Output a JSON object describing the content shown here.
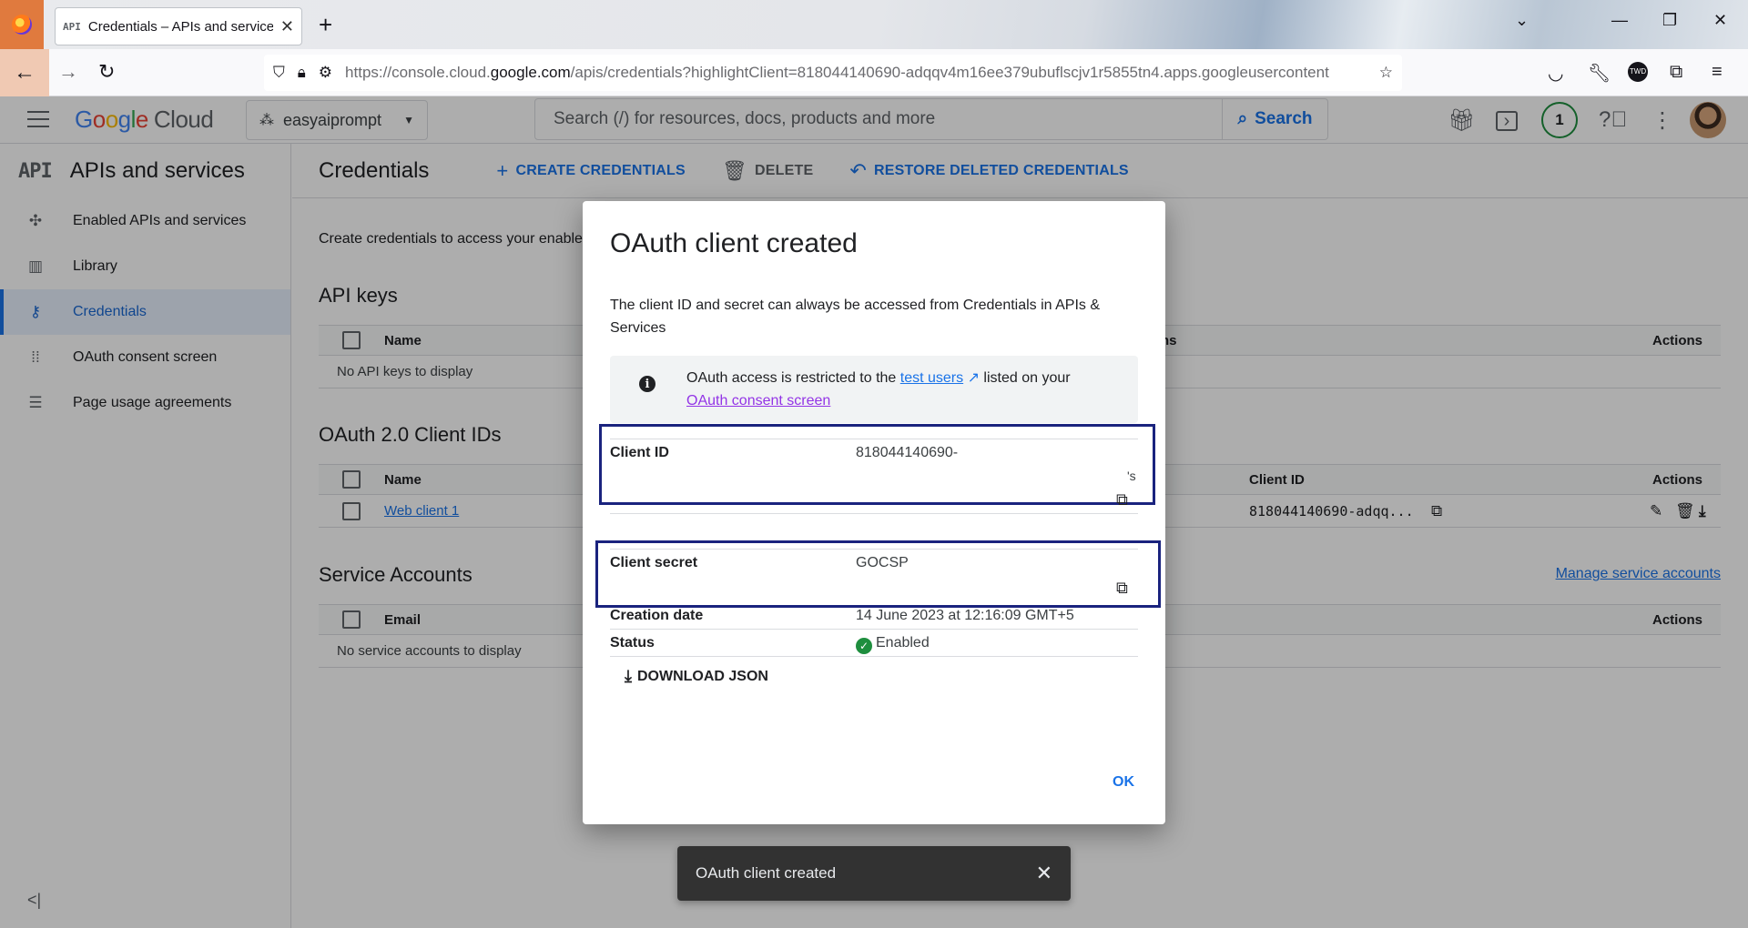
{
  "browser": {
    "tab_title": "Credentials – APIs and services",
    "tab_favicon": "API",
    "url_prefix": "https://console.cloud.",
    "url_domain": "google.com",
    "url_rest": "/apis/credentials?highlightClient=818044140690-adqqv4m16ee379ubuflscjv1r5855tn4.apps.googleusercontent"
  },
  "header": {
    "logo_letters": [
      "G",
      "o",
      "o",
      "g",
      "l",
      "e"
    ],
    "logo_suffix": "Cloud",
    "project_name": "easyaiprompt",
    "search_placeholder": "Search (/) for resources, docs, products and more",
    "search_button": "Search",
    "notifications_count": "1"
  },
  "sidebar": {
    "product_abbr": "API",
    "product_title": "APIs and services",
    "items": [
      {
        "label": "Enabled APIs and services",
        "icon": "enabled-apis-icon"
      },
      {
        "label": "Library",
        "icon": "library-icon"
      },
      {
        "label": "Credentials",
        "icon": "key-icon"
      },
      {
        "label": "OAuth consent screen",
        "icon": "consent-screen-icon"
      },
      {
        "label": "Page usage agreements",
        "icon": "settings-list-icon"
      }
    ],
    "active_index": 2
  },
  "toolbar": {
    "page_title": "Credentials",
    "create_label": "CREATE CREDENTIALS",
    "delete_label": "DELETE",
    "restore_label": "RESTORE DELETED CREDENTIALS"
  },
  "main": {
    "intro_text": "Create credentials to access your enable",
    "api_keys": {
      "title": "API keys",
      "col_name": "Name",
      "col_restrictions_tail": "ns",
      "col_actions": "Actions",
      "empty": "No API keys to display"
    },
    "oauth": {
      "title": "OAuth 2.0 Client IDs",
      "col_name": "Name",
      "col_client_id": "Client ID",
      "col_actions": "Actions",
      "rows": [
        {
          "name": "Web client 1",
          "client_id": "818044140690-adqq..."
        }
      ]
    },
    "service_accounts": {
      "title": "Service Accounts",
      "manage_link": "Manage service accounts",
      "col_email": "Email",
      "col_actions": "Actions",
      "empty": "No service accounts to display"
    }
  },
  "dialog": {
    "title": "OAuth client created",
    "description": "The client ID and secret can always be accessed from Credentials in APIs & Services",
    "info_pre": "OAuth access is restricted to the ",
    "info_link1": "test users",
    "info_mid": " listed on your ",
    "info_link2": "OAuth consent screen",
    "client_id_label": "Client ID",
    "client_id_value": "818044140690-",
    "client_id_tail": "'s",
    "client_secret_label": "Client secret",
    "client_secret_value": "GOCSP",
    "creation_date_label": "Creation date",
    "creation_date_value": "14 June 2023 at 12:16:09 GMT+5",
    "status_label": "Status",
    "status_value": "Enabled",
    "download_label": "DOWNLOAD JSON",
    "ok_label": "OK"
  },
  "snackbar": {
    "message": "OAuth client created"
  },
  "colors": {
    "accent": "#1a73e8",
    "highlight_border": "#1a237e",
    "enabled_green": "#1e8e3e"
  }
}
